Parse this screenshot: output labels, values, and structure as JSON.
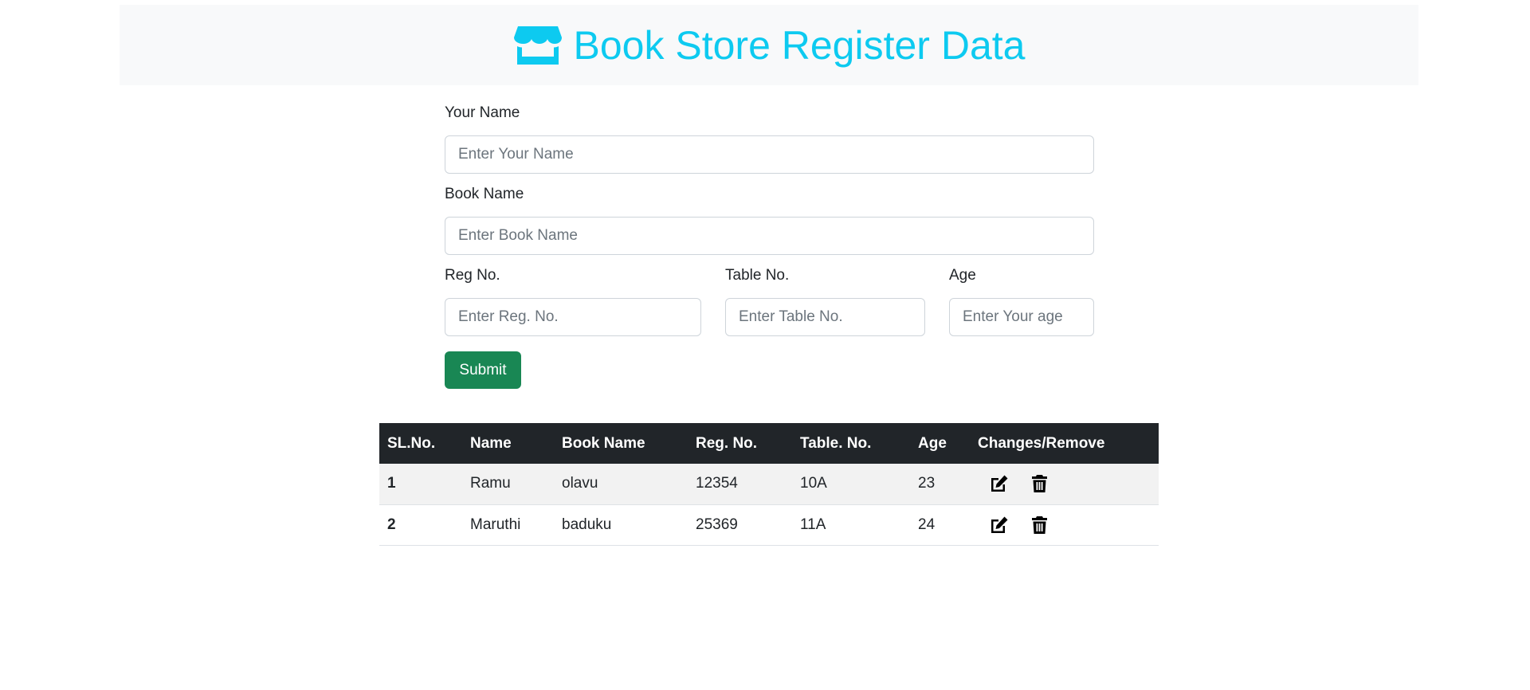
{
  "header": {
    "title": "Book Store Register Data",
    "icon": "store-icon",
    "accent_color": "#0dcaf0"
  },
  "form": {
    "name_label": "Your Name",
    "name_placeholder": "Enter Your Name",
    "name_value": "",
    "book_label": "Book Name",
    "book_placeholder": "Enter Book Name",
    "book_value": "",
    "reg_label": "Reg No.",
    "reg_placeholder": "Enter Reg. No.",
    "reg_value": "",
    "table_label": "Table No.",
    "table_placeholder": "Enter Table No.",
    "table_value": "",
    "age_label": "Age",
    "age_placeholder": "Enter Your age",
    "age_value": "",
    "submit_label": "Submit",
    "submit_color": "#198754"
  },
  "table": {
    "columns": [
      "SL.No.",
      "Name",
      "Book Name",
      "Reg. No.",
      "Table. No.",
      "Age",
      "Changes/Remove"
    ],
    "rows": [
      {
        "sl": "1",
        "name": "Ramu",
        "book": "olavu",
        "reg": "12354",
        "table": "10A",
        "age": "23",
        "edit_icon": "edit-icon",
        "delete_icon": "trash-icon"
      },
      {
        "sl": "2",
        "name": "Maruthi",
        "book": "baduku",
        "reg": "25369",
        "table": "11A",
        "age": "24",
        "edit_icon": "edit-icon",
        "delete_icon": "trash-icon"
      }
    ]
  }
}
